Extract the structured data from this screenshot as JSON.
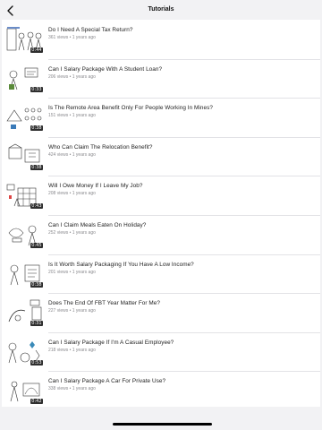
{
  "header": {
    "title": "Tutorials",
    "back_icon": "chevron-left-icon"
  },
  "videos": [
    {
      "title": "Do I Need A Special Tax Return?",
      "meta": "361 views • 1 years ago",
      "duration": "0:44"
    },
    {
      "title": "Can I Salary Package With A Student Loan?",
      "meta": "206 views • 1 years ago",
      "duration": "0:33"
    },
    {
      "title": "Is The Remote Area Benefit Only For People Working In Mines?",
      "meta": "151 views • 1 years ago",
      "duration": "0:38"
    },
    {
      "title": "Who Can Claim The Relocation Benefit?",
      "meta": "424 views • 1 years ago",
      "duration": "0:38"
    },
    {
      "title": "Will I Owe Money If I Leave My Job?",
      "meta": "208 views • 1 years ago",
      "duration": "0:43"
    },
    {
      "title": "Can I Claim Meals Eaten On Holiday?",
      "meta": "252 views • 1 years ago",
      "duration": "0:45"
    },
    {
      "title": "Is It Worth Salary Packaging If You Have A Low Income?",
      "meta": "201 views • 1 years ago",
      "duration": "0:38"
    },
    {
      "title": "Does The End Of FBT Year Matter For Me?",
      "meta": "227 views • 1 years ago",
      "duration": "0:31"
    },
    {
      "title": "Can I Salary Package If I'm A Casual Employee?",
      "meta": "218 views • 1 years ago",
      "duration": "0:53"
    },
    {
      "title": "Can I Salary Package A Car For Private Use?",
      "meta": "338 views • 1 years ago",
      "duration": "0:42"
    }
  ],
  "colors": {
    "background": "#f2f2f4",
    "list_background": "#ffffff",
    "meta_text": "#8a8a8e",
    "duration_badge": "#000000"
  }
}
